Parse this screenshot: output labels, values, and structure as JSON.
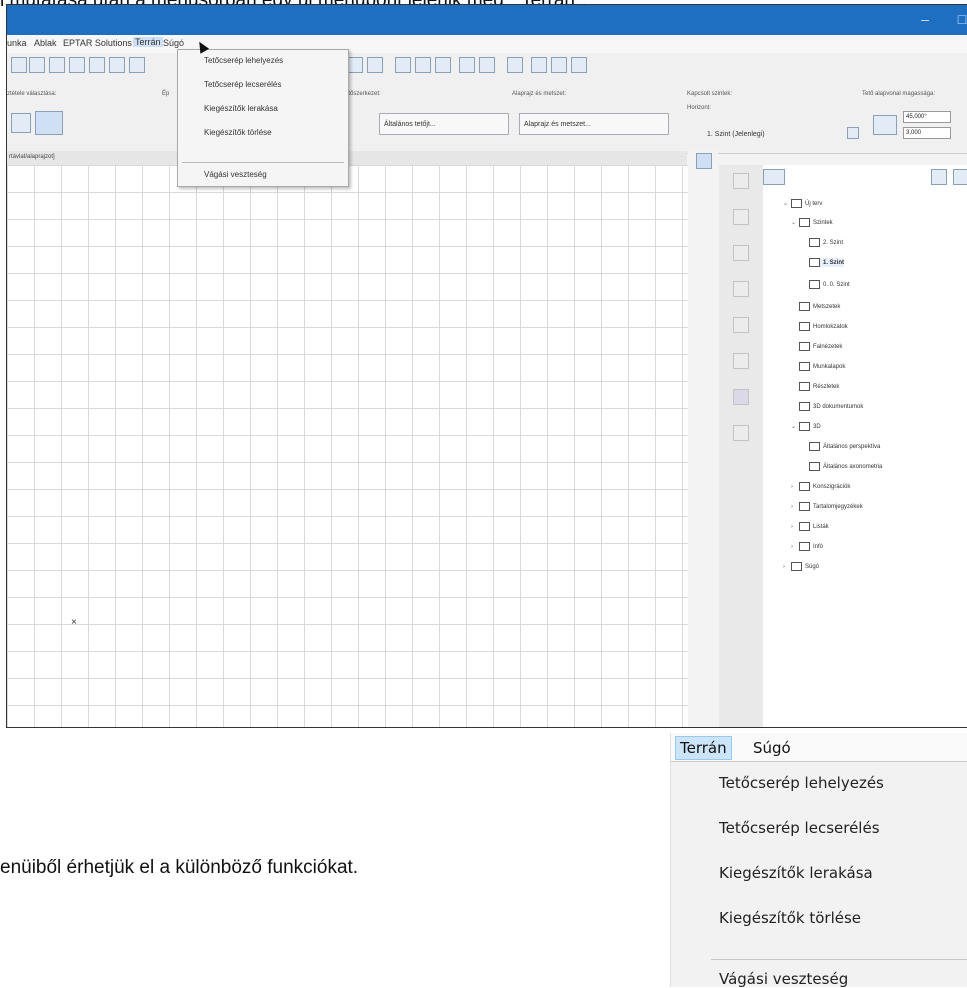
{
  "document": {
    "top_line": "l mutatása után a menüsorban egy új menüpont jelenik meg: \"Terrán\".",
    "bottom_line": "enüiből érhetjük el a különböző funkciókat."
  },
  "app": {
    "window_buttons": [
      "–",
      "□"
    ],
    "menubar": {
      "items": [
        "unka",
        "Ablak",
        "EPTAR Solutions",
        "Terrán",
        "Súgó"
      ],
      "active": "Terrán"
    },
    "toolbar": {
      "groups": [
        "ztétele választása:",
        "Ép",
        "Tetőszerkezet:",
        "Alaprajz és metszet:",
        "Kapcsolt szintek:",
        "Tető alapvonal magassága:"
      ],
      "buttons": [
        "Általános tetőjt...",
        "Alaprajz és metszet..."
      ],
      "horizont_label": "Horizont:",
      "floor_select": "1. Szint (Jelenlegi)",
      "angle_value": "45,000°",
      "height_value": "3,000"
    },
    "tab_label": "rtávlat/alaprajzot]",
    "dropdown": {
      "items": [
        "Tetőcserép lehelyezés",
        "Tetőcserép lecserélés",
        "Kiegészítők lerakása",
        "Kiegészítők törlése",
        "Vágási veszteség"
      ]
    },
    "navigator": {
      "rows": [
        {
          "label": "Új terv",
          "bold": false
        },
        {
          "label": "Szintek",
          "bold": false
        },
        {
          "label": "2. Szint",
          "bold": false
        },
        {
          "label": "1. Szint",
          "bold": true
        },
        {
          "label": "0. 0. Szint",
          "bold": false
        },
        {
          "label": "Metszetek",
          "bold": false
        },
        {
          "label": "Homlokzatok",
          "bold": false
        },
        {
          "label": "Falnézetek",
          "bold": false
        },
        {
          "label": "Munkalapok",
          "bold": false
        },
        {
          "label": "Részletek",
          "bold": false
        },
        {
          "label": "3D dokumentumok",
          "bold": false
        },
        {
          "label": "3D",
          "bold": false
        },
        {
          "label": "Általános perspektíva",
          "bold": false
        },
        {
          "label": "Általános axonometria",
          "bold": false
        },
        {
          "label": "Konszigrációk",
          "bold": false
        },
        {
          "label": "Tartalomjegyzékek",
          "bold": false
        },
        {
          "label": "Listák",
          "bold": false
        },
        {
          "label": "Infó",
          "bold": false
        },
        {
          "label": "Súgó",
          "bold": false
        }
      ]
    },
    "grid_marker": "×"
  },
  "zoom_menu": {
    "menubar": [
      "Terrán",
      "Súgó"
    ],
    "items": [
      "Tetőcserép lehelyezés",
      "Tetőcserép lecserélés",
      "Kiegészítők lerakása",
      "Kiegészítők törlése",
      "Vágási veszteség"
    ]
  }
}
